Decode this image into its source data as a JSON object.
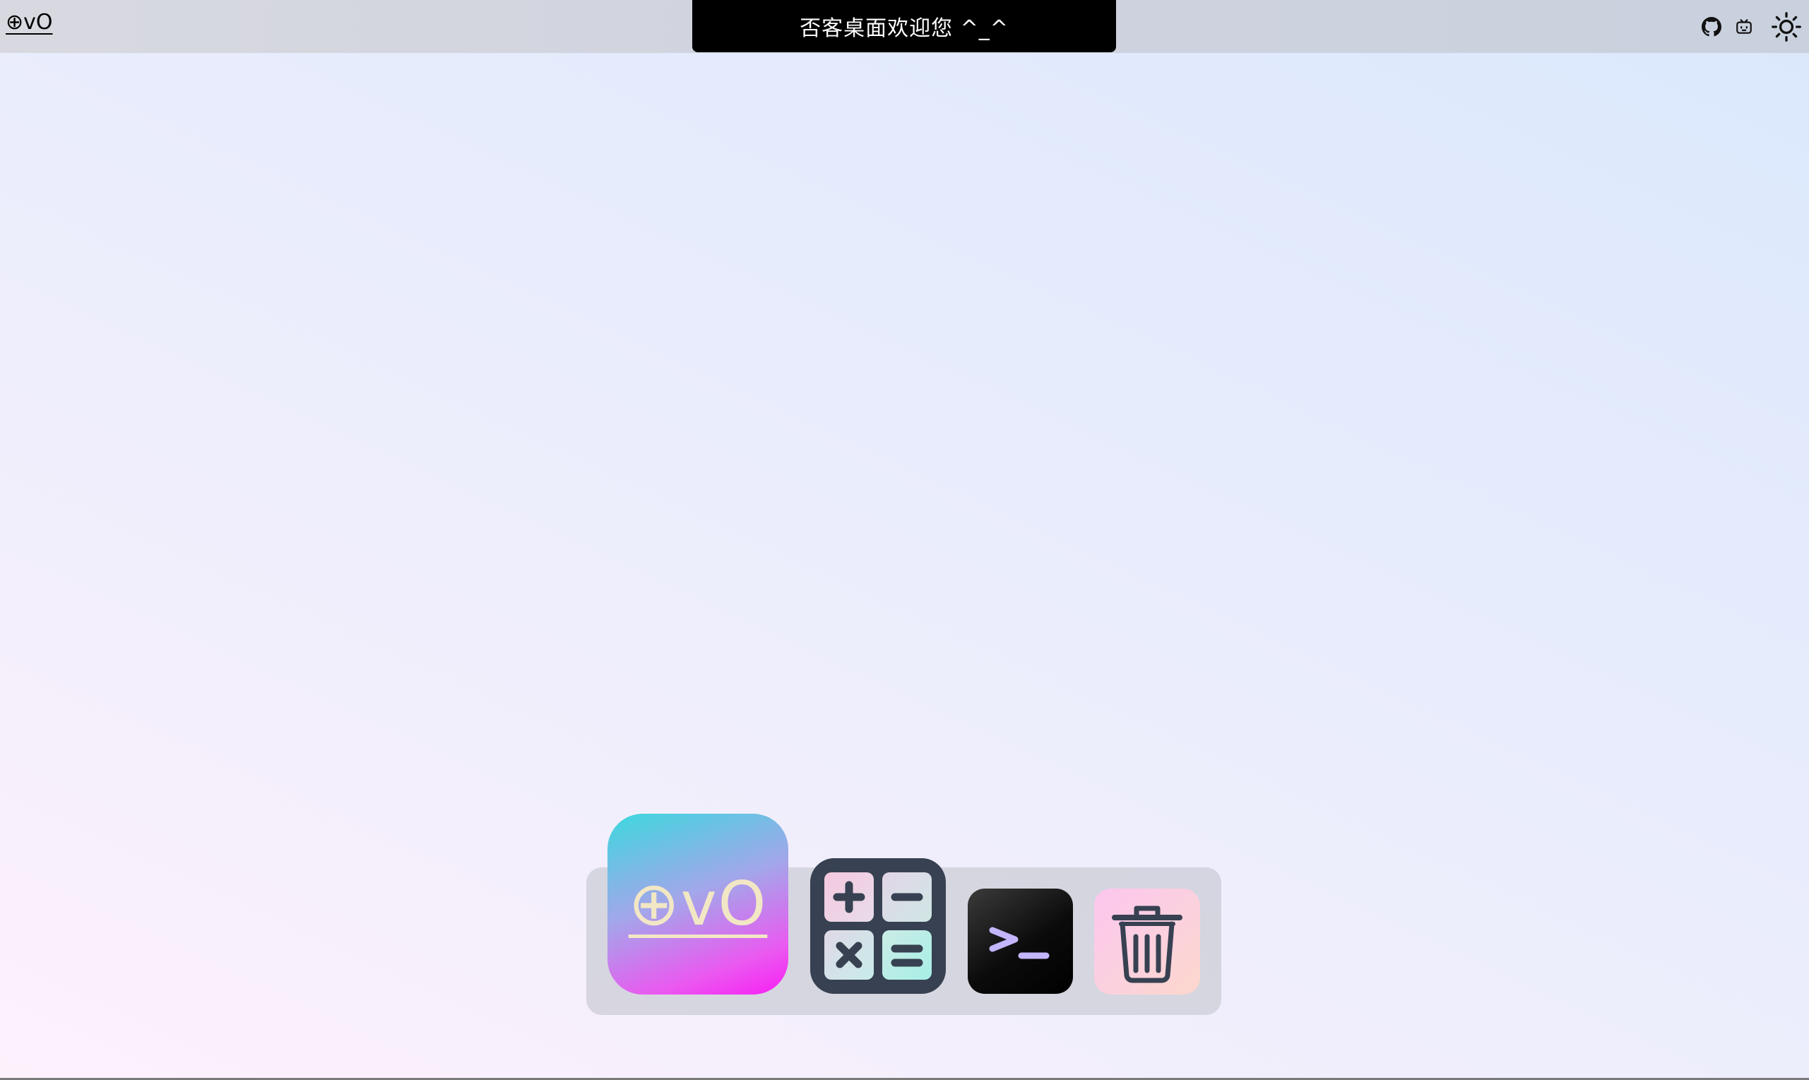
{
  "topbar": {
    "brand": "⊕vO",
    "welcome": "否客桌面欢迎您 ^_^",
    "icons": [
      "github-icon",
      "bilibili-icon",
      "sun-icon"
    ]
  },
  "dock": {
    "apps": [
      {
        "name": "home",
        "label": "⊕vO"
      },
      {
        "name": "calculator",
        "icon": "calculator-icon"
      },
      {
        "name": "terminal",
        "label": ">_"
      },
      {
        "name": "trash",
        "icon": "trash-icon"
      }
    ]
  },
  "colors": {
    "welcome_bg": "#000000",
    "calculator_bg": "#374151",
    "terminal_prompt": "#c4b5fd",
    "home_gradient": [
      "#3dd8de",
      "#f81ef4"
    ]
  }
}
